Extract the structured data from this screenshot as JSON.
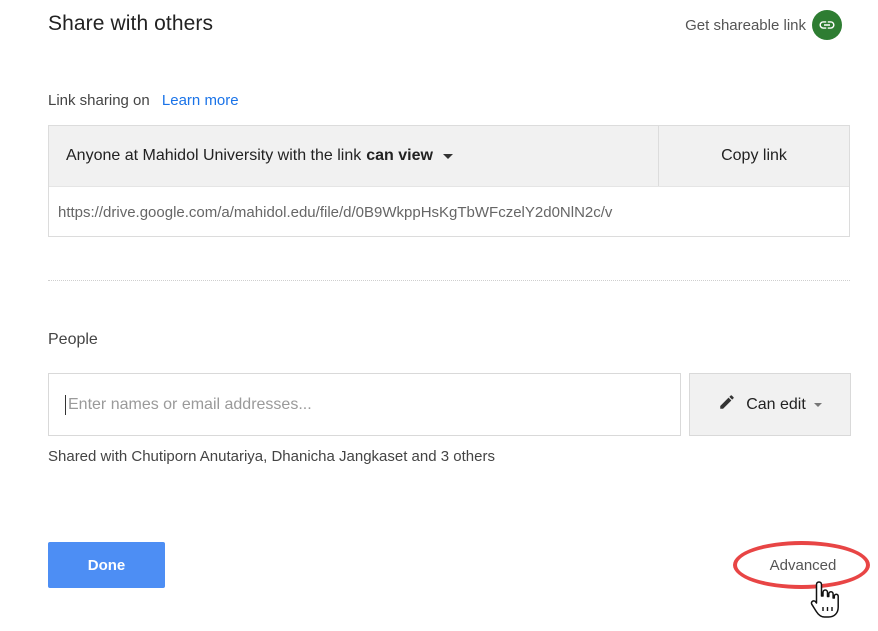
{
  "dialog": {
    "title": "Share with others",
    "get_link_label": "Get shareable link",
    "link_sharing": {
      "status": "Link sharing on",
      "learn_more": "Learn more",
      "access_text": "Anyone at Mahidol University with the link",
      "access_level": "can view",
      "copy_label": "Copy link",
      "url": "https://drive.google.com/a/mahidol.edu/file/d/0B9WkppHsKgTbWFczelY2d0NlN2c/v"
    },
    "people": {
      "label": "People",
      "placeholder": "Enter names or email addresses...",
      "permission": "Can edit",
      "shared_with": "Shared with Chutiporn Anutariya, Dhanicha Jangkaset and 3 others"
    },
    "done_label": "Done",
    "advanced_label": "Advanced"
  },
  "colors": {
    "primary_button": "#4d8ef4",
    "link": "#1a73e8",
    "share_link_icon_bg": "#2e7d32",
    "highlight_ring": "#e84545"
  },
  "icons": [
    "link-icon",
    "pencil-icon",
    "dropdown-caret-icon",
    "hand-cursor-icon"
  ]
}
